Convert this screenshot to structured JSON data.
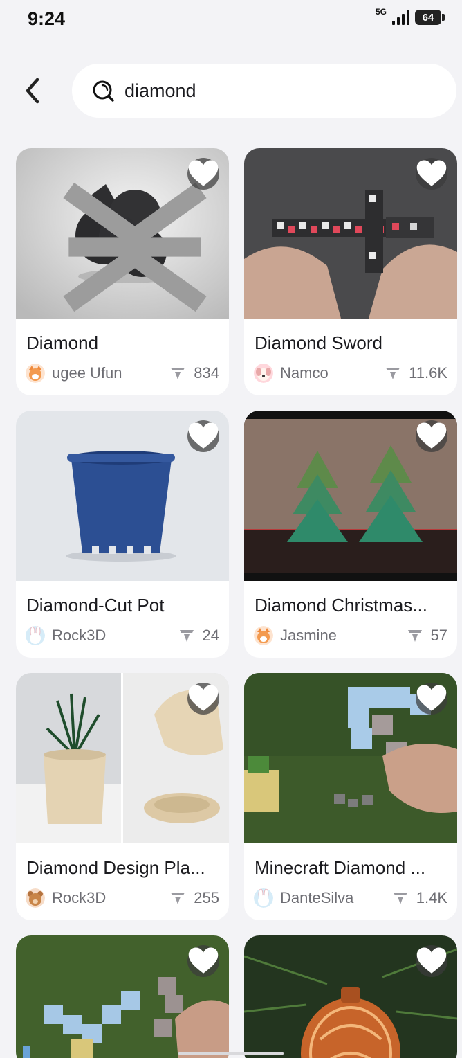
{
  "status": {
    "time": "9:24",
    "network": "5G",
    "battery": "64"
  },
  "search": {
    "value": "diamond",
    "placeholder": ""
  },
  "icons": {
    "back": "chevron-left-icon",
    "search": "search-icon",
    "favorite": "heart-icon",
    "downloads": "download-icon"
  },
  "colors": {
    "background": "#f3f3f6",
    "card": "#ffffff",
    "text_primary": "#1b1b1f",
    "text_secondary": "#6e6e74"
  },
  "cards": [
    {
      "title": "Diamond",
      "author": "ugee Ufun",
      "count": "834",
      "thumb": "black club-shaped model on grey background",
      "avatar": "fox-avatar"
    },
    {
      "title": "Diamond Sword",
      "author": "Namco",
      "count": "11.6K",
      "thumb": "hands holding pixel sword",
      "avatar": "dog-avatar"
    },
    {
      "title": "Diamond-Cut Pot",
      "author": "Rock3D",
      "count": "24",
      "thumb": "blue plant pot",
      "avatar": "bunny-avatar"
    },
    {
      "title": "Diamond Christmas...",
      "author": "Jasmine",
      "count": "57",
      "thumb": "two green geometric christmas trees",
      "avatar": "fox-avatar"
    },
    {
      "title": "Diamond Design Pla...",
      "author": "Rock3D",
      "count": "255",
      "thumb": "textured beige planters",
      "avatar": "bear-avatar"
    },
    {
      "title": "Minecraft Diamond ...",
      "author": "DanteSilva",
      "count": "1.4K",
      "thumb": "hand holding pixel pickaxe",
      "avatar": "bunny-avatar"
    },
    {
      "title": "",
      "author": "",
      "count": "",
      "thumb": "hand holding pixel sword on grass",
      "avatar": ""
    },
    {
      "title": "",
      "author": "",
      "count": "",
      "thumb": "orange lattice ornament on pine branch",
      "avatar": ""
    }
  ]
}
